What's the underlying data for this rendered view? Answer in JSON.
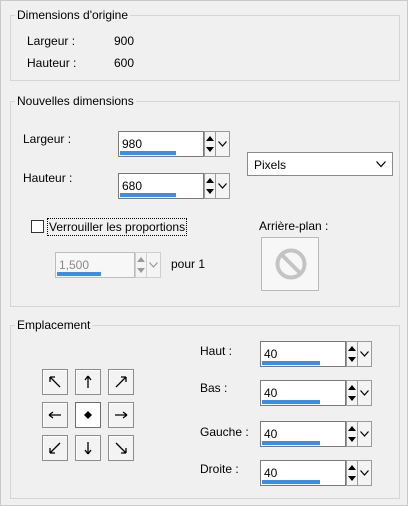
{
  "original": {
    "title": "Dimensions d'origine",
    "width_label": "Largeur :",
    "width_value": "900",
    "height_label": "Hauteur :",
    "height_value": "600"
  },
  "new_dims": {
    "title": "Nouvelles dimensions",
    "width_label": "Largeur :",
    "width_value": "980",
    "height_label": "Hauteur :",
    "height_value": "680",
    "unit_selected": "Pixels",
    "lock_label": "Verrouiller les proportions",
    "lock_checked": false,
    "ratio_value": "1,500",
    "ratio_suffix": "pour 1",
    "background_label": "Arrière-plan :"
  },
  "placement": {
    "title": "Emplacement",
    "top_label": "Haut :",
    "top_value": "40",
    "bottom_label": "Bas :",
    "bottom_value": "40",
    "left_label": "Gauche :",
    "left_value": "40",
    "right_label": "Droite :",
    "right_value": "40",
    "anchor_selected": "center",
    "slider_accent": "#3a8ee6"
  }
}
